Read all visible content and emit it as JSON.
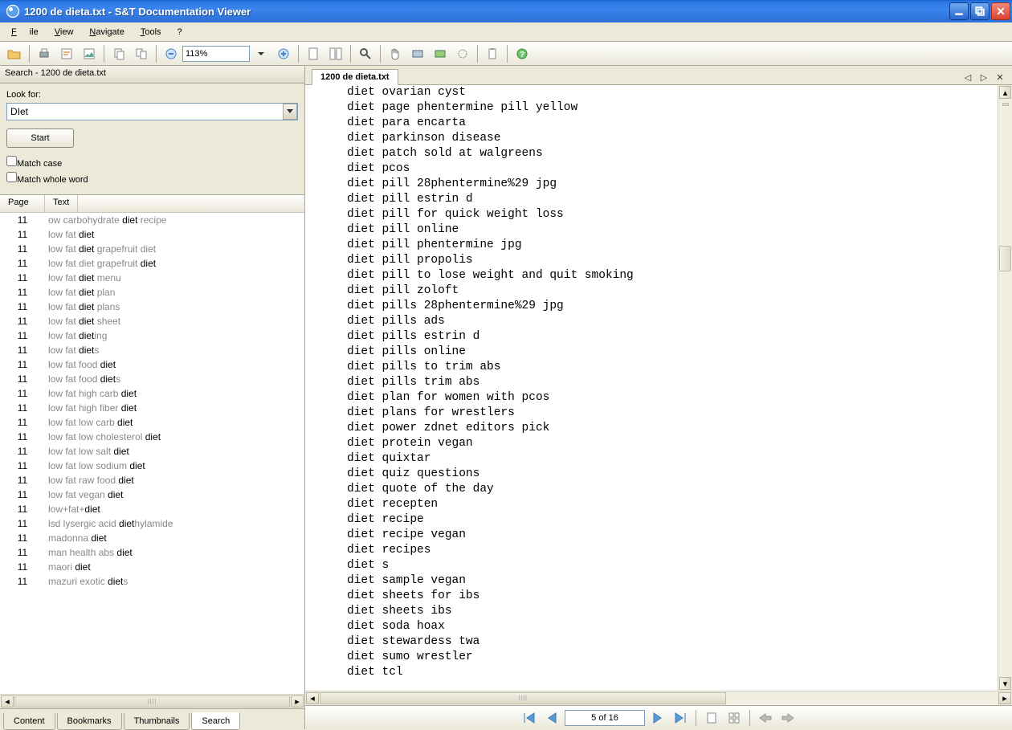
{
  "window": {
    "title": "1200 de dieta.txt - S&T Documentation Viewer"
  },
  "menu": {
    "file": "File",
    "view": "View",
    "navigate": "Navigate",
    "tools": "Tools",
    "help": "?"
  },
  "toolbar": {
    "zoom": "113%"
  },
  "search": {
    "pane_title": "Search - 1200 de dieta.txt",
    "look_for_label": "Look for:",
    "query": "DIet",
    "start_label": "Start",
    "match_case_label": "Match case",
    "match_whole_word_label": "Match whole word",
    "col_page": "Page",
    "col_text": "Text",
    "results": [
      {
        "page": "11",
        "text_parts": [
          "ow carbohydrate ",
          "diet",
          " recipe"
        ]
      },
      {
        "page": "11",
        "text_parts": [
          "low fat ",
          "diet",
          ""
        ]
      },
      {
        "page": "11",
        "text_parts": [
          "low fat ",
          "diet",
          " grapefruit diet"
        ]
      },
      {
        "page": "11",
        "text_parts": [
          "low fat diet grapefruit ",
          "diet",
          ""
        ]
      },
      {
        "page": "11",
        "text_parts": [
          "low fat ",
          "diet",
          " menu"
        ]
      },
      {
        "page": "11",
        "text_parts": [
          "low fat ",
          "diet",
          " plan"
        ]
      },
      {
        "page": "11",
        "text_parts": [
          "low fat ",
          "diet",
          " plans"
        ]
      },
      {
        "page": "11",
        "text_parts": [
          "low fat ",
          "diet",
          " sheet"
        ]
      },
      {
        "page": "11",
        "text_parts": [
          "low fat ",
          "diet",
          "ing"
        ]
      },
      {
        "page": "11",
        "text_parts": [
          "low fat ",
          "diet",
          "s"
        ]
      },
      {
        "page": "11",
        "text_parts": [
          "low fat food ",
          "diet",
          ""
        ]
      },
      {
        "page": "11",
        "text_parts": [
          "low fat food ",
          "diet",
          "s"
        ]
      },
      {
        "page": "11",
        "text_parts": [
          "low fat high carb ",
          "diet",
          ""
        ]
      },
      {
        "page": "11",
        "text_parts": [
          "low fat high fiber ",
          "diet",
          ""
        ]
      },
      {
        "page": "11",
        "text_parts": [
          "low fat low carb ",
          "diet",
          ""
        ]
      },
      {
        "page": "11",
        "text_parts": [
          "low fat low cholesterol ",
          "diet",
          ""
        ]
      },
      {
        "page": "11",
        "text_parts": [
          "low fat low salt ",
          "diet",
          ""
        ]
      },
      {
        "page": "11",
        "text_parts": [
          "low fat low sodium ",
          "diet",
          ""
        ]
      },
      {
        "page": "11",
        "text_parts": [
          "low fat raw food ",
          "diet",
          ""
        ]
      },
      {
        "page": "11",
        "text_parts": [
          "low fat vegan ",
          "diet",
          ""
        ]
      },
      {
        "page": "11",
        "text_parts": [
          "low+fat+",
          "diet",
          ""
        ]
      },
      {
        "page": "11",
        "text_parts": [
          "lsd lysergic acid ",
          "diet",
          "hylamide"
        ]
      },
      {
        "page": "11",
        "text_parts": [
          "madonna ",
          "diet",
          ""
        ]
      },
      {
        "page": "11",
        "text_parts": [
          "man health abs ",
          "diet",
          ""
        ]
      },
      {
        "page": "11",
        "text_parts": [
          "maori ",
          "diet",
          ""
        ]
      },
      {
        "page": "11",
        "text_parts": [
          "mazuri exotic ",
          "diet",
          "s"
        ]
      }
    ]
  },
  "left_tabs": {
    "content": "Content",
    "bookmarks": "Bookmarks",
    "thumbnails": "Thumbnails",
    "search": "Search"
  },
  "doc": {
    "tab_title": "1200 de dieta.txt",
    "lines": [
      "diet ovarian cyst",
      "diet page phentermine pill yellow",
      "diet para encarta",
      "diet parkinson disease",
      "diet patch sold at walgreens",
      "diet pcos",
      "diet pill 28phentermine%29 jpg",
      "diet pill estrin d",
      "diet pill for quick weight loss",
      "diet pill online",
      "diet pill phentermine jpg",
      "diet pill propolis",
      "diet pill to lose weight and quit smoking",
      "diet pill zoloft",
      "diet pills 28phentermine%29 jpg",
      "diet pills ads",
      "diet pills estrin d",
      "diet pills online",
      "diet pills to trim abs",
      "diet pills trim abs",
      "diet plan for women with pcos",
      "diet plans for wrestlers",
      "diet power zdnet editors pick",
      "diet protein vegan",
      "diet quixtar",
      "diet quiz questions",
      "diet quote of the day",
      "diet recepten",
      "diet recipe",
      "diet recipe vegan",
      "diet recipes",
      "diet s",
      "diet sample vegan",
      "diet sheets for ibs",
      "diet sheets ibs",
      "diet soda hoax",
      "diet stewardess twa",
      "diet sumo wrestler",
      "diet tcl"
    ],
    "page_status": "5 of 16"
  }
}
